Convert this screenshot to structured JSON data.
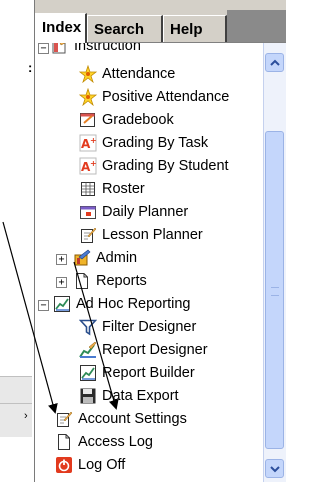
{
  "tabs": [
    {
      "label": "Index",
      "active": true
    },
    {
      "label": "Search",
      "active": false
    },
    {
      "label": "Help",
      "active": false
    }
  ],
  "tree": {
    "instruction": "Instruction",
    "attendance": "Attendance",
    "positive_attendance": "Positive Attendance",
    "gradebook": "Gradebook",
    "grading_by_task": "Grading By Task",
    "grading_by_student": "Grading By Student",
    "roster": "Roster",
    "daily_planner": "Daily Planner",
    "lesson_planner": "Lesson Planner",
    "admin": "Admin",
    "reports": "Reports",
    "ad_hoc_reporting": "Ad Hoc Reporting",
    "filter_designer": "Filter Designer",
    "report_designer": "Report Designer",
    "report_builder": "Report Builder",
    "data_export": "Data Export",
    "account_settings": "Account Settings",
    "access_log": "Access Log",
    "log_off": "Log Off"
  },
  "expanders": {
    "collapsed": "+",
    "expanded": "−"
  },
  "left_fragments": {
    "top": ":",
    "bottom": "›"
  },
  "colors": {
    "tab_bg": "#d4d0c8",
    "scrollbar": "#c4d6fb",
    "accent_red": "#e23a1e"
  }
}
